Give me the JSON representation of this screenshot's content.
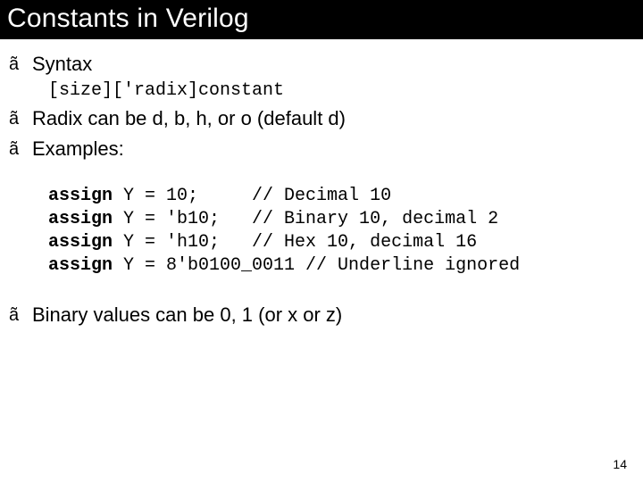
{
  "title": "Constants in Verilog",
  "bullets": {
    "syntax": "Syntax",
    "radix": "Radix can be d, b, h, or o (default d)",
    "examples": "Examples:",
    "binary": "Binary values can be 0, 1 (or x or z)"
  },
  "syntax_code": "[size]['radix]constant",
  "code": {
    "kw": "assign",
    "l1_rest": " Y = 10;     // Decimal 10",
    "l2_rest": " Y = 'b10;   // Binary 10, decimal 2",
    "l3_rest": " Y = 'h10;   // Hex 10, decimal 16",
    "l4_rest": " Y = 8'b0100_0011 // Underline ignored"
  },
  "bullet_char": "ã",
  "page_number": "14"
}
